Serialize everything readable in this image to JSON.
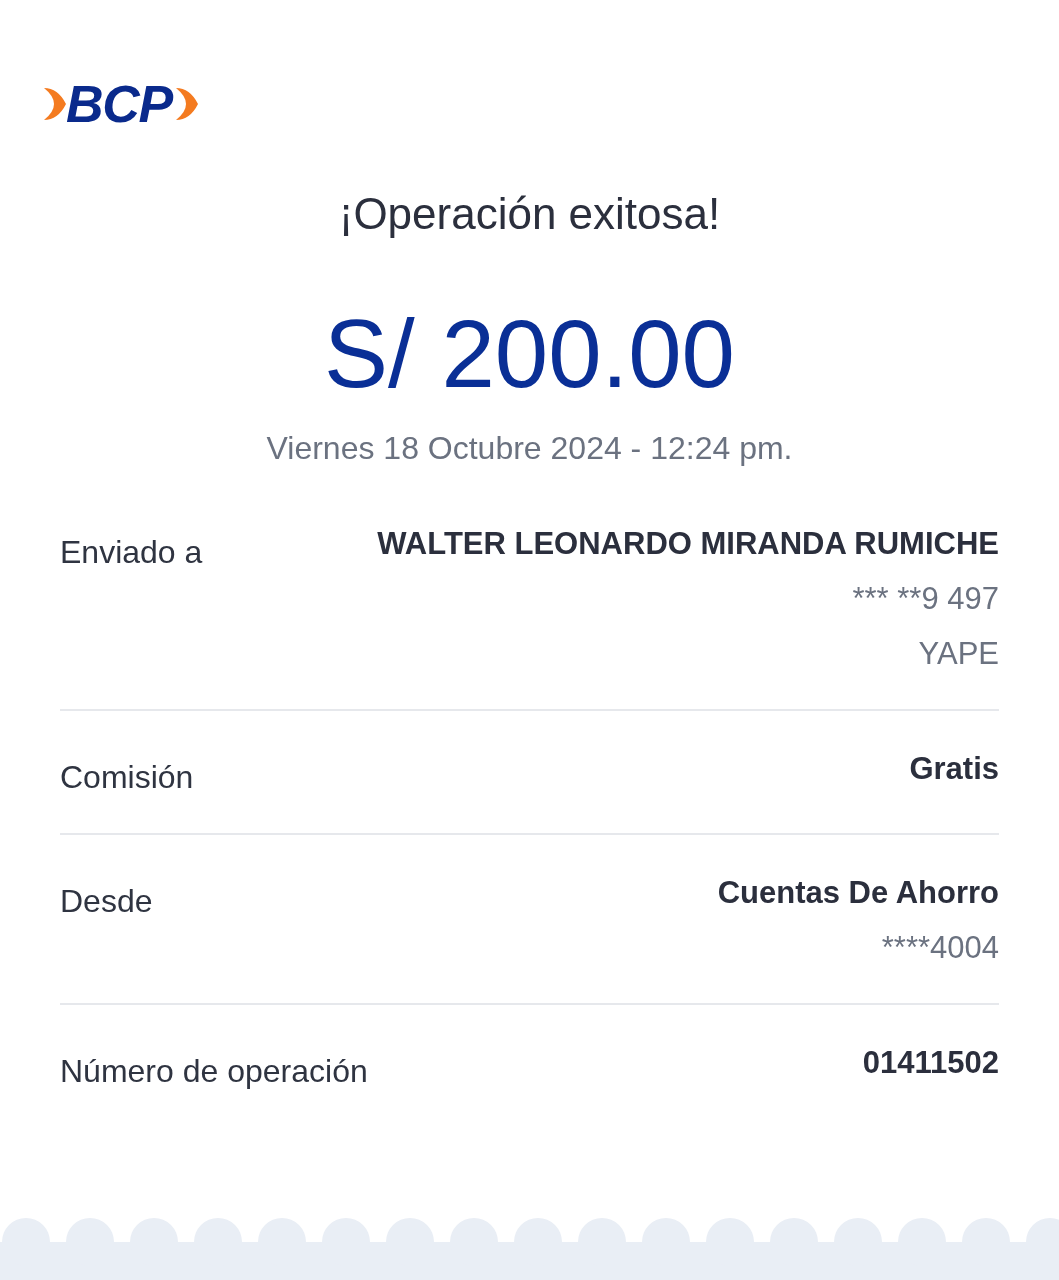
{
  "logo": {
    "text": "BCP"
  },
  "title": "¡Operación exitosa!",
  "amount": "S/ 200.00",
  "datetime": "Viernes 18 Octubre 2024 - 12:24 pm.",
  "rows": [
    {
      "label": "Enviado a",
      "value": "WALTER LEONARDO MIRANDA RUMICHE",
      "details": [
        "*** **9 497",
        "YAPE"
      ]
    },
    {
      "label": "Comisión",
      "value": "Gratis",
      "details": []
    },
    {
      "label": "Desde",
      "value": "Cuentas De Ahorro",
      "details": [
        "****4004"
      ]
    },
    {
      "label": "Número de operación",
      "value": "01411502",
      "details": []
    }
  ]
}
